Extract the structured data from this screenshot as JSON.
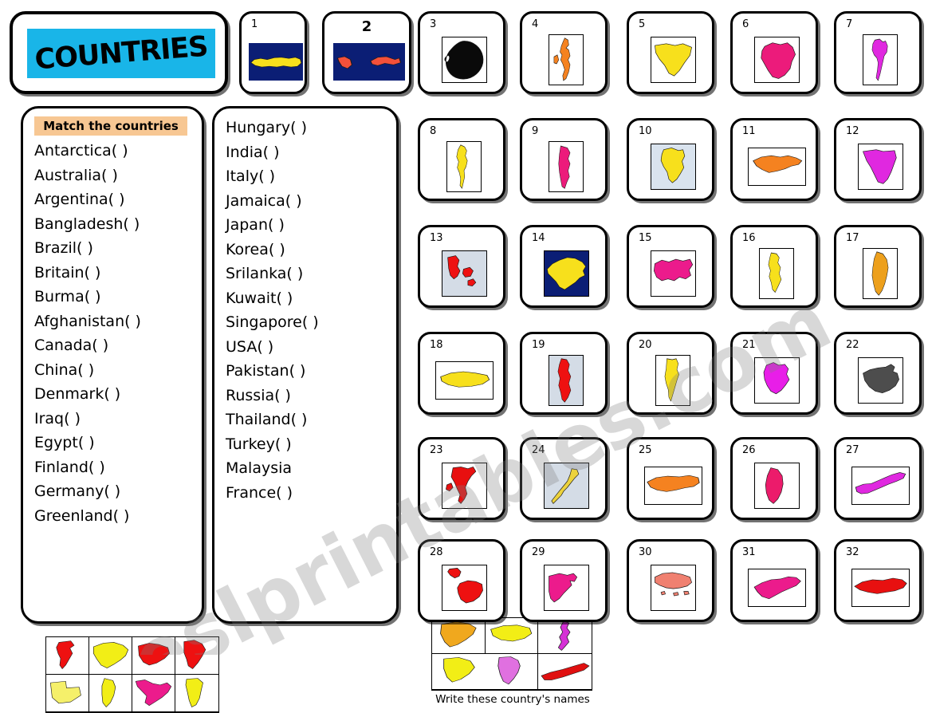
{
  "title": {
    "text": "COUNTRIES",
    "banner_color": "#19b5e8"
  },
  "instructions": {
    "match_header": "Match the countries",
    "write_caption": "Write these country's names"
  },
  "watermark": {
    "text": "eslprintables.com"
  },
  "list_left": [
    "Antarctica(   )",
    "Australia(   )",
    "Argentina(   )",
    "Bangladesh(   )",
    "Brazil(   )",
    "Britain(   )",
    "Burma(   )",
    "Afghanistan(   )",
    "Canada(   )",
    "China(   )",
    "Denmark(   )",
    "Iraq(   )",
    "Egypt(   )",
    "Finland(   )",
    "Germany(   )",
    "Greenland(   )"
  ],
  "list_right": [
    "Hungary(   )",
    "India(   )",
    "Italy(   )",
    "Jamaica(   )",
    "Japan(   )",
    "Korea(   )",
    "Srilanka(   )",
    "Kuwait(   )",
    "Singapore(   )",
    "USA(   )",
    "Pakistan(   )",
    "Russia(   )",
    "Thailand(   )",
    "Turkey(   )",
    "Malaysia",
    "France(   )"
  ],
  "grid_left_shapes": [
    {
      "name": "jordan-shape",
      "color": "#ee1111"
    },
    {
      "name": "saudi-arabia-shape",
      "color": "#f2ee16"
    },
    {
      "name": "yemen-shape",
      "color": "#ee1111"
    },
    {
      "name": "oman-shape",
      "color": "#ee1111"
    },
    {
      "name": "western-sahara-shape",
      "color": "#f5f06a"
    },
    {
      "name": "qatar-shape",
      "color": "#f2ee16"
    },
    {
      "name": "mexico-shape",
      "color": "#ec1b8c"
    },
    {
      "name": "uae-shape",
      "color": "#f2ee16"
    }
  ],
  "grid_right_shapes": [
    {
      "name": "netherlands-orange-shape",
      "color": "#f0a81e"
    },
    {
      "name": "belgium-shape",
      "color": "#f2ee16"
    },
    {
      "name": "chile-shape",
      "color": "#d631d6"
    },
    {
      "name": "luxembourg-shape",
      "color": "#f2ee16"
    },
    {
      "name": "netherlands-shape",
      "color": "#e070e0"
    },
    {
      "name": "cuba-shape",
      "color": "#e01010"
    }
  ],
  "cards": [
    {
      "num": "1",
      "country": "turkey",
      "fill": "#f7e01c",
      "bg": "#0b1e75",
      "frame": "wide",
      "num_center": false
    },
    {
      "num": "2",
      "country": "malaysia",
      "fill": "#f4503a",
      "bg": "#0b1e75",
      "frame": "wide",
      "num_center": true
    },
    {
      "num": "3",
      "country": "antarctica",
      "fill": "#0a0a0a",
      "bg": "#ffffff",
      "frame": "square",
      "num_center": false
    },
    {
      "num": "4",
      "country": "britain",
      "fill": "#f58220",
      "bg": "#ffffff",
      "frame": "tall",
      "num_center": false
    },
    {
      "num": "5",
      "country": "iraq",
      "fill": "#f7e01c",
      "bg": "#ffffff",
      "frame": "square",
      "num_center": false
    },
    {
      "num": "6",
      "country": "brazil",
      "fill": "#ec1b7b",
      "bg": "#ffffff",
      "frame": "square",
      "num_center": false
    },
    {
      "num": "7",
      "country": "thailand",
      "fill": "#e028e0",
      "bg": "#ffffff",
      "frame": "tall",
      "num_center": false
    },
    {
      "num": "8",
      "country": "burma",
      "fill": "#f7e01c",
      "bg": "#ffffff",
      "frame": "tall",
      "num_center": false
    },
    {
      "num": "9",
      "country": "argentina",
      "fill": "#ec1b7b",
      "bg": "#ffffff",
      "frame": "tall",
      "num_center": false
    },
    {
      "num": "10",
      "country": "bangladesh",
      "fill": "#f7e01c",
      "bg": "#d9e3ee",
      "frame": "square",
      "num_center": false
    },
    {
      "num": "11",
      "country": "afghanistan",
      "fill": "#f58220",
      "bg": "#ffffff",
      "frame": "wide",
      "num_center": false
    },
    {
      "num": "12",
      "country": "egypt",
      "fill": "#e028e0",
      "bg": "#ffffff",
      "frame": "square",
      "num_center": false
    },
    {
      "num": "13",
      "country": "denmark",
      "fill": "#ee1111",
      "bg": "#d4dce6",
      "frame": "square",
      "num_center": false
    },
    {
      "num": "14",
      "country": "china",
      "fill": "#f7e01c",
      "bg": "#0b1e75",
      "frame": "square",
      "num_center": false
    },
    {
      "num": "15",
      "country": "canada",
      "fill": "#ec1b8c",
      "bg": "#ffffff",
      "frame": "square",
      "num_center": false
    },
    {
      "num": "16",
      "country": "germany",
      "fill": "#f7e01c",
      "bg": "#ffffff",
      "frame": "tall",
      "num_center": false
    },
    {
      "num": "17",
      "country": "greenland",
      "fill": "#eda01c",
      "bg": "#ffffff",
      "frame": "tall",
      "num_center": false
    },
    {
      "num": "18",
      "country": "hungary",
      "fill": "#f7e01c",
      "bg": "#ffffff",
      "frame": "wide",
      "num_center": false
    },
    {
      "num": "19",
      "country": "finland",
      "fill": "#ee1111",
      "bg": "#d4dce6",
      "frame": "tall",
      "num_center": false
    },
    {
      "num": "20",
      "country": "india",
      "fill": "#f7e01c",
      "bg": "#ffffff",
      "frame": "tall",
      "num_center": false
    },
    {
      "num": "21",
      "country": "france",
      "fill": "#e81ee8",
      "bg": "#ffffff",
      "frame": "square",
      "num_center": false
    },
    {
      "num": "22",
      "country": "australia",
      "fill": "#4d4d4d",
      "bg": "#ffffff",
      "frame": "square",
      "num_center": false
    },
    {
      "num": "23",
      "country": "italy",
      "fill": "#e81010",
      "bg": "#ffffff",
      "frame": "square",
      "num_center": false
    },
    {
      "num": "24",
      "country": "japan",
      "fill": "#ecd23c",
      "bg": "#d4dce6",
      "frame": "square",
      "num_center": false
    },
    {
      "num": "25",
      "country": "russia",
      "fill": "#f58220",
      "bg": "#ffffff",
      "frame": "wide",
      "num_center": false
    },
    {
      "num": "26",
      "country": "srilanka",
      "fill": "#ec1b6b",
      "bg": "#ffffff",
      "frame": "square",
      "num_center": false
    },
    {
      "num": "27",
      "country": "korea",
      "fill": "#e028e0",
      "bg": "#ffffff",
      "frame": "wide",
      "num_center": false
    },
    {
      "num": "28",
      "country": "usa",
      "fill": "#ee1111",
      "bg": "#ffffff",
      "frame": "square",
      "num_center": false
    },
    {
      "num": "29",
      "country": "kuwait",
      "fill": "#ec1b8c",
      "bg": "#ffffff",
      "frame": "square",
      "num_center": false
    },
    {
      "num": "30",
      "country": "singapore",
      "fill": "#f08070",
      "bg": "#ffffff",
      "frame": "square",
      "num_center": false
    },
    {
      "num": "31",
      "country": "pakistan",
      "fill": "#ec1b8c",
      "bg": "#ffffff",
      "frame": "wide",
      "num_center": false
    },
    {
      "num": "32",
      "country": "russia2",
      "fill": "#e81010",
      "bg": "#ffffff",
      "frame": "wide",
      "num_center": false
    }
  ]
}
